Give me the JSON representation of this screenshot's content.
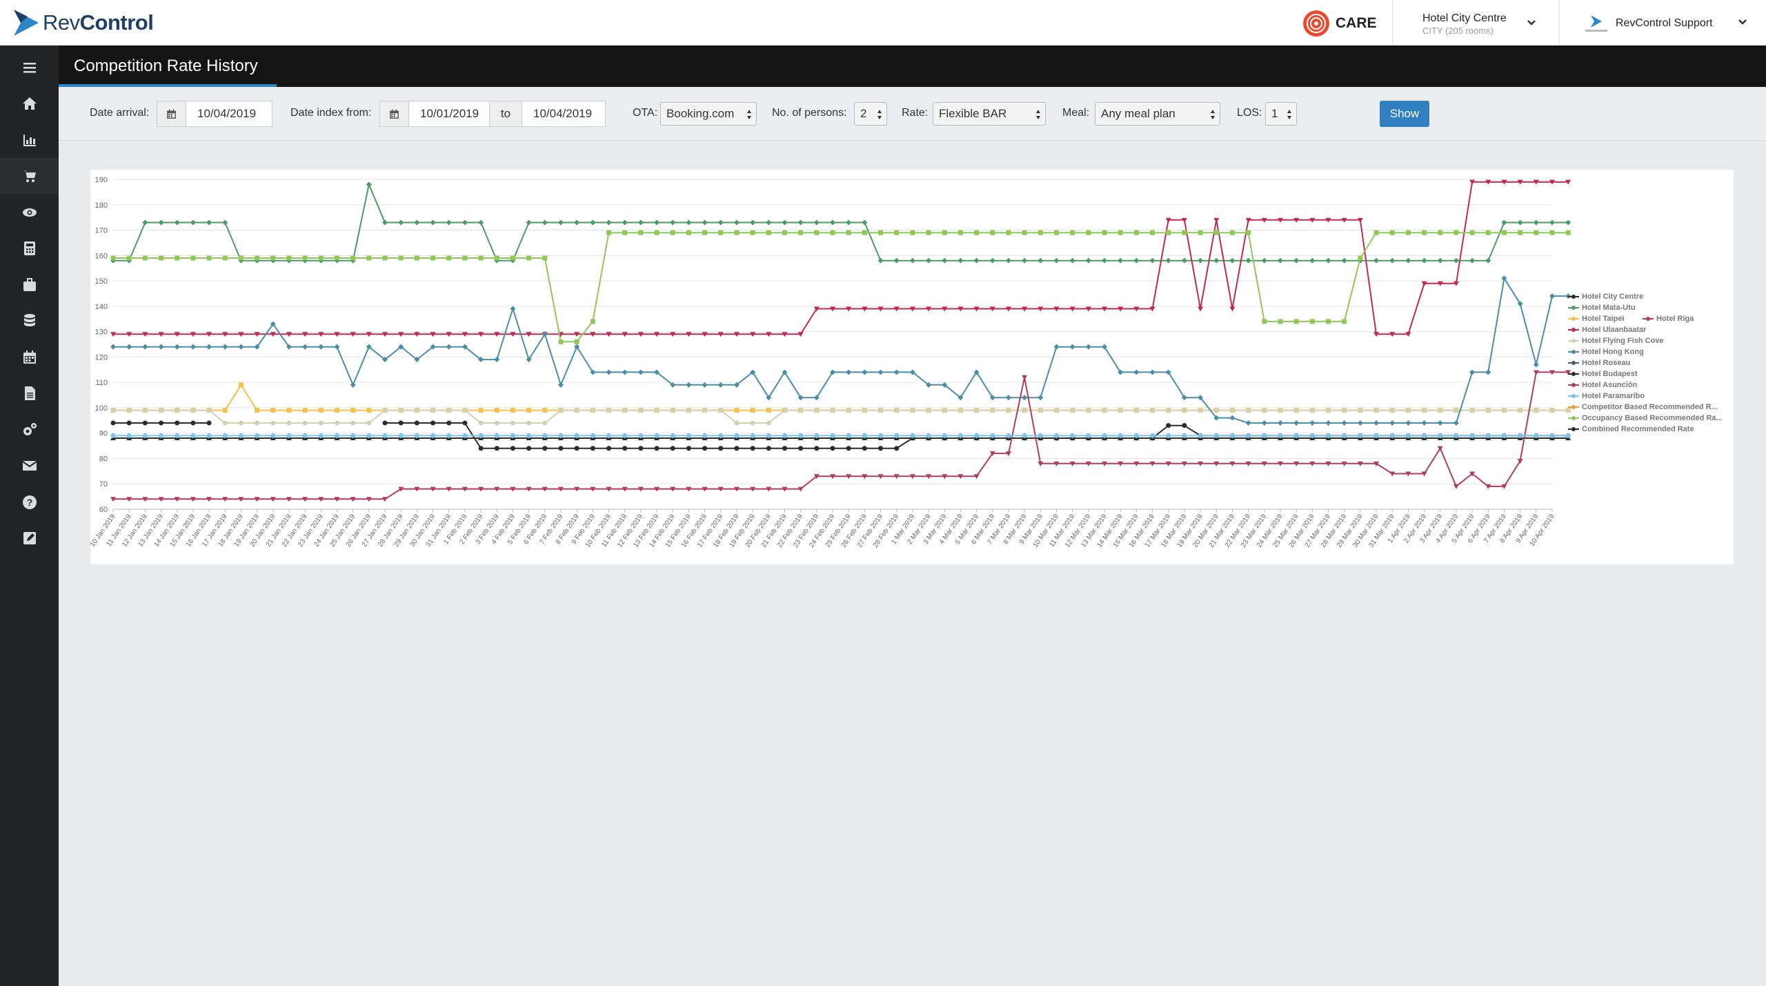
{
  "app": {
    "brand_rev": "Rev",
    "brand_control": "Control",
    "care_label": "CARE"
  },
  "header": {
    "hotel_name": "Hotel City Centre",
    "hotel_sub": "CITY (205 rooms)",
    "user_name": "RevControl Support"
  },
  "sidebar": {
    "items": [
      "home-icon",
      "bar-chart-icon",
      "cart-icon",
      "eye-icon",
      "calculator-icon",
      "briefcase-icon",
      "database-icon",
      "calendar-icon",
      "document-icon",
      "cogs-icon",
      "envelope-icon",
      "question-icon",
      "edit-icon"
    ],
    "active_index": 2
  },
  "page": {
    "title": "Competition Rate History"
  },
  "filters": {
    "date_arrival_label": "Date arrival:",
    "date_arrival": "10/04/2019",
    "date_index_label": "Date index from:",
    "date_from": "10/01/2019",
    "to_label": "to",
    "date_to": "10/04/2019",
    "ota_label": "OTA:",
    "ota": "Booking.com",
    "persons_label": "No. of persons:",
    "persons": "2",
    "rate_label": "Rate:",
    "rate": "Flexible BAR",
    "meal_label": "Meal:",
    "meal": "Any meal plan",
    "los_label": "LOS:",
    "los": "1",
    "show_label": "Show"
  },
  "chart_data": {
    "type": "line",
    "ylim": [
      60,
      190
    ],
    "yticks": [
      60,
      70,
      80,
      90,
      100,
      110,
      120,
      130,
      140,
      150,
      160,
      170,
      180,
      190
    ],
    "x_start": "10 Jan 2019",
    "x_end": "10 Apr 2019",
    "categories": [
      "10 Jan 2019",
      "11 Jan 2019",
      "12 Jan 2019",
      "13 Jan 2019",
      "14 Jan 2019",
      "15 Jan 2019",
      "16 Jan 2019",
      "17 Jan 2019",
      "18 Jan 2019",
      "19 Jan 2019",
      "20 Jan 2019",
      "21 Jan 2019",
      "22 Jan 2019",
      "23 Jan 2019",
      "24 Jan 2019",
      "25 Jan 2019",
      "26 Jan 2019",
      "27 Jan 2019",
      "28 Jan 2019",
      "29 Jan 2019",
      "30 Jan 2019",
      "31 Jan 2019",
      "1 Feb 2019",
      "2 Feb 2019",
      "3 Feb 2019",
      "4 Feb 2019",
      "5 Feb 2019",
      "6 Feb 2019",
      "7 Feb 2019",
      "8 Feb 2019",
      "9 Feb 2019",
      "10 Feb 2019",
      "11 Feb 2019",
      "12 Feb 2019",
      "13 Feb 2019",
      "14 Feb 2019",
      "15 Feb 2019",
      "16 Feb 2019",
      "17 Feb 2019",
      "18 Feb 2019",
      "19 Feb 2019",
      "20 Feb 2019",
      "21 Feb 2019",
      "22 Feb 2019",
      "23 Feb 2019",
      "24 Feb 2019",
      "25 Feb 2019",
      "26 Feb 2019",
      "27 Feb 2019",
      "28 Feb 2019",
      "1 Mar 2019",
      "2 Mar 2019",
      "3 Mar 2019",
      "4 Mar 2019",
      "5 Mar 2019",
      "6 Mar 2019",
      "7 Mar 2019",
      "8 Mar 2019",
      "9 Mar 2019",
      "10 Mar 2019",
      "11 Mar 2019",
      "12 Mar 2019",
      "13 Mar 2019",
      "14 Mar 2019",
      "15 Mar 2019",
      "16 Mar 2019",
      "17 Mar 2019",
      "18 Mar 2019",
      "19 Mar 2019",
      "20 Mar 2019",
      "21 Mar 2019",
      "22 Mar 2019",
      "23 Mar 2019",
      "24 Mar 2019",
      "25 Mar 2019",
      "26 Mar 2019",
      "27 Mar 2019",
      "28 Mar 2019",
      "29 Mar 2019",
      "30 Mar 2019",
      "31 Mar 2019",
      "1 Apr 2019",
      "2 Apr 2019",
      "3 Apr 2019",
      "4 Apr 2019",
      "5 Apr 2019",
      "6 Apr 2019",
      "7 Apr 2019",
      "8 Apr 2019",
      "9 Apr 2019",
      "10 Apr 2019"
    ],
    "legend_placement": "right",
    "series": [
      {
        "name": "Hotel City Centre",
        "color": "#2b2b2b",
        "marker": "circle",
        "segments": [
          [
            0,
            94
          ],
          [
            6,
            94
          ],
          [
            7,
            null
          ],
          [
            16,
            null
          ],
          [
            17,
            94
          ],
          [
            22,
            94
          ],
          [
            23,
            84
          ],
          [
            49,
            84
          ],
          [
            50,
            88
          ],
          [
            65,
            88
          ],
          [
            66,
            93
          ],
          [
            67,
            93
          ],
          [
            68,
            89
          ],
          [
            91,
            89
          ]
        ]
      },
      {
        "name": "Hotel Mata-Utu",
        "color": "#4c9a67",
        "marker": "diamond",
        "segments": [
          [
            0,
            158
          ],
          [
            1,
            158
          ],
          [
            2,
            173
          ],
          [
            7,
            173
          ],
          [
            8,
            158
          ],
          [
            15,
            158
          ],
          [
            16,
            188
          ],
          [
            17,
            173
          ],
          [
            23,
            173
          ],
          [
            24,
            158
          ],
          [
            25,
            158
          ],
          [
            26,
            173
          ],
          [
            47,
            173
          ],
          [
            48,
            158
          ],
          [
            90,
            158
          ],
          [
            91,
            158
          ],
          [
            86,
            158
          ],
          [
            87,
            173
          ],
          [
            91,
            173
          ]
        ]
      },
      {
        "name": "Hotel Taipei",
        "color": "#f4c24a",
        "marker": "square",
        "segments": [
          [
            0,
            99
          ],
          [
            7,
            99
          ],
          [
            8,
            109
          ],
          [
            9,
            99
          ],
          [
            91,
            99
          ]
        ]
      },
      {
        "name": "Hotel Ulaanbaatar",
        "color": "#c0294f",
        "marker": "triangle-down",
        "segments": [
          [
            0,
            129
          ],
          [
            43,
            129
          ],
          [
            44,
            139
          ],
          [
            65,
            139
          ],
          [
            66,
            174
          ],
          [
            67,
            174
          ],
          [
            68,
            139
          ],
          [
            69,
            174
          ],
          [
            70,
            139
          ],
          [
            71,
            174
          ],
          [
            78,
            174
          ],
          [
            79,
            129
          ],
          [
            81,
            129
          ],
          [
            82,
            149
          ],
          [
            84,
            149
          ],
          [
            85,
            189
          ],
          [
            91,
            189
          ]
        ]
      },
      {
        "name": "Hotel Flying Fish Cove",
        "color": "#d4cfae",
        "marker": "circle",
        "segments": [
          [
            0,
            99
          ],
          [
            6,
            99
          ],
          [
            7,
            94
          ],
          [
            16,
            94
          ],
          [
            17,
            99
          ],
          [
            22,
            99
          ],
          [
            23,
            94
          ],
          [
            27,
            94
          ],
          [
            28,
            99
          ],
          [
            38,
            99
          ],
          [
            39,
            94
          ],
          [
            41,
            94
          ],
          [
            42,
            99
          ],
          [
            91,
            99
          ]
        ]
      },
      {
        "name": "Hotel Hong Kong",
        "color": "#4a8ea6",
        "marker": "diamond",
        "segments": [
          [
            0,
            124
          ],
          [
            9,
            124
          ],
          [
            10,
            133
          ],
          [
            11,
            124
          ],
          [
            14,
            124
          ],
          [
            15,
            109
          ],
          [
            16,
            124
          ],
          [
            17,
            119
          ],
          [
            18,
            124
          ],
          [
            19,
            119
          ],
          [
            20,
            124
          ],
          [
            22,
            124
          ],
          [
            23,
            119
          ],
          [
            24,
            119
          ],
          [
            25,
            139
          ],
          [
            26,
            119
          ],
          [
            27,
            129
          ],
          [
            28,
            109
          ],
          [
            29,
            124
          ],
          [
            30,
            114
          ],
          [
            34,
            114
          ],
          [
            35,
            109
          ],
          [
            39,
            109
          ],
          [
            40,
            114
          ],
          [
            41,
            104
          ],
          [
            42,
            114
          ],
          [
            43,
            104
          ],
          [
            44,
            104
          ],
          [
            45,
            114
          ],
          [
            50,
            114
          ],
          [
            51,
            109
          ],
          [
            52,
            109
          ],
          [
            53,
            104
          ],
          [
            54,
            114
          ],
          [
            55,
            104
          ],
          [
            57,
            104
          ],
          [
            58,
            104
          ],
          [
            59,
            124
          ],
          [
            62,
            124
          ],
          [
            63,
            114
          ],
          [
            66,
            114
          ],
          [
            67,
            104
          ],
          [
            68,
            104
          ],
          [
            69,
            96
          ],
          [
            70,
            96
          ],
          [
            71,
            94
          ],
          [
            73,
            94
          ],
          [
            74,
            94
          ],
          [
            84,
            94
          ],
          [
            85,
            114
          ],
          [
            86,
            114
          ],
          [
            87,
            151
          ],
          [
            88,
            141
          ],
          [
            89,
            117
          ],
          [
            90,
            144
          ],
          [
            91,
            144
          ]
        ]
      },
      {
        "name": "Hotel Budapest",
        "color": "#2b2b2b",
        "marker": "triangle-up",
        "segments": [
          [
            0,
            88
          ],
          [
            91,
            88
          ]
        ]
      },
      {
        "name": "Hotel Asunción",
        "color": "#b03a63",
        "marker": "triangle-down",
        "segments": [
          [
            0,
            64
          ],
          [
            16,
            64
          ],
          [
            17,
            64
          ],
          [
            18,
            68
          ],
          [
            43,
            68
          ],
          [
            44,
            73
          ],
          [
            54,
            73
          ],
          [
            55,
            82
          ],
          [
            56,
            82
          ],
          [
            57,
            112
          ],
          [
            58,
            78
          ],
          [
            79,
            78
          ],
          [
            80,
            74
          ],
          [
            82,
            74
          ],
          [
            83,
            84
          ],
          [
            84,
            69
          ],
          [
            85,
            74
          ],
          [
            86,
            69
          ],
          [
            87,
            69
          ],
          [
            88,
            79
          ],
          [
            89,
            114
          ],
          [
            90,
            114
          ],
          [
            91,
            114
          ]
        ]
      },
      {
        "name": "Hotel Paramaribo",
        "color": "#7cc4ea",
        "marker": "circle",
        "segments": [
          [
            0,
            89
          ],
          [
            91,
            89
          ]
        ]
      },
      {
        "name": "Occupancy Based Recommended Rate",
        "color": "#8fc856",
        "marker": "square",
        "segments": [
          [
            0,
            159
          ],
          [
            27,
            159
          ],
          [
            28,
            126
          ],
          [
            29,
            126
          ],
          [
            30,
            134
          ],
          [
            31,
            169
          ],
          [
            70,
            169
          ],
          [
            71,
            169
          ],
          [
            72,
            134
          ],
          [
            73,
            134
          ],
          [
            77,
            134
          ],
          [
            78,
            159
          ],
          [
            79,
            169
          ],
          [
            91,
            169
          ]
        ]
      }
    ],
    "legend": [
      "Hotel City Centre",
      "Hotel Mata-Utu",
      "Hotel Taipei",
      "Hotel Riga",
      "Hotel Ulaanbaatar",
      "Hotel Flying Fish Cove",
      "Hotel Hong Kong",
      "Hotel Roseau",
      "Hotel Budapest",
      "Hotel Asunción",
      "Hotel Paramaribo",
      "Competitor Based Recommended R...",
      "Occupancy Based Recommended Ra...",
      "Combined Recommended Rate"
    ],
    "legend_colors": [
      "#2b2b2b",
      "#4c9a67",
      "#f4c24a",
      "#b03a63",
      "#c0294f",
      "#d4cfae",
      "#4a8ea6",
      "#4a5a7a",
      "#2b2b2b",
      "#b03a63",
      "#7cc4ea",
      "#f39c30",
      "#8fc856",
      "#2b2b2b"
    ]
  }
}
